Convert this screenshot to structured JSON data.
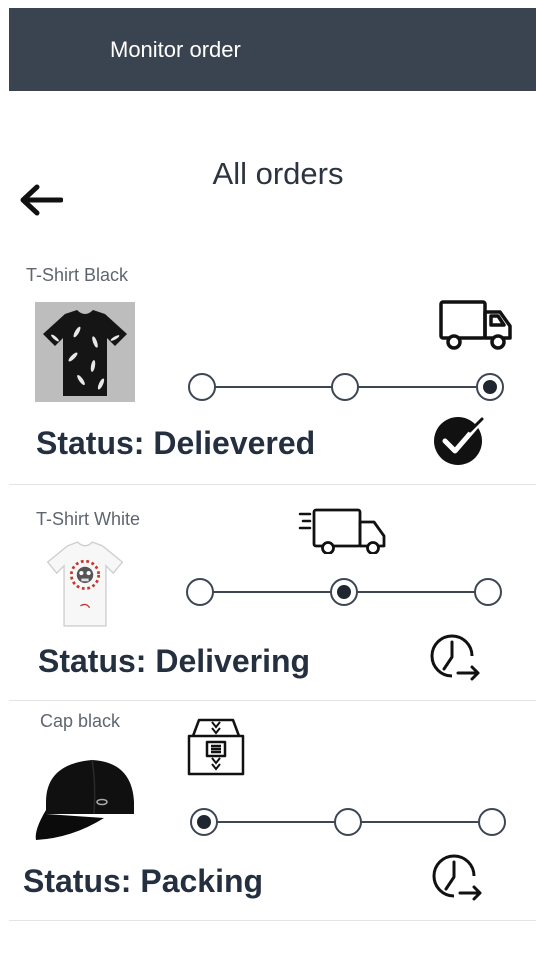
{
  "header": {
    "title": "Monitor order"
  },
  "page": {
    "title": "All orders"
  },
  "orders": [
    {
      "name": "T-Shirt Black",
      "status": "Status: Delievered",
      "progress_step": 3,
      "steps_total": 3,
      "stage_icon": "truck-icon",
      "status_icon": "check-circle-icon"
    },
    {
      "name": "T-Shirt White",
      "status": "Status: Delivering",
      "progress_step": 2,
      "steps_total": 3,
      "stage_icon": "fast-truck-icon",
      "status_icon": "clock-arrow-icon"
    },
    {
      "name": "Cap black",
      "status": "Status: Packing",
      "progress_step": 1,
      "steps_total": 3,
      "stage_icon": "package-box-icon",
      "status_icon": "clock-arrow-icon"
    }
  ],
  "colors": {
    "header_bg": "#3a4350",
    "text": "#2b3440"
  }
}
